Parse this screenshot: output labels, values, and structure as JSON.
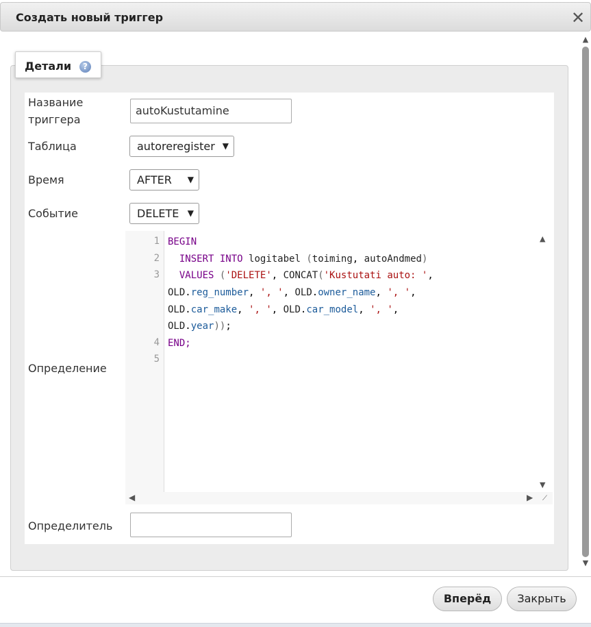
{
  "dialog": {
    "title": "Создать новый триггер",
    "close_icon": "close-icon"
  },
  "tab": {
    "label": "Детали",
    "help_icon": "question-icon"
  },
  "form": {
    "name_label": "Название триггера",
    "name_value": "autoKustutamine",
    "table_label": "Таблица",
    "table_value": "autoreregister",
    "time_label": "Время",
    "time_value": "AFTER",
    "event_label": "Событие",
    "event_value": "DELETE",
    "definition_label": "Определение",
    "definer_label": "Определитель",
    "definer_value": ""
  },
  "editor": {
    "line_numbers": [
      "1",
      "2",
      "3",
      "4",
      "5"
    ],
    "code": [
      "BEGIN",
      "  INSERT INTO logitabel (toiming, autoAndmed)",
      "  VALUES ('DELETE', CONCAT('Kustutati auto: ',",
      "OLD.reg_number, ', ', OLD.owner_name, ', ',",
      "OLD.car_make, ', ', OLD.car_model, ', ',",
      "OLD.year));",
      "END;",
      ""
    ]
  },
  "buttons": {
    "forward": "Вперёд",
    "close": "Закрыть"
  },
  "colors": {
    "keyword": "#770088",
    "string": "#aa1111",
    "property": "#1c5b9a"
  }
}
